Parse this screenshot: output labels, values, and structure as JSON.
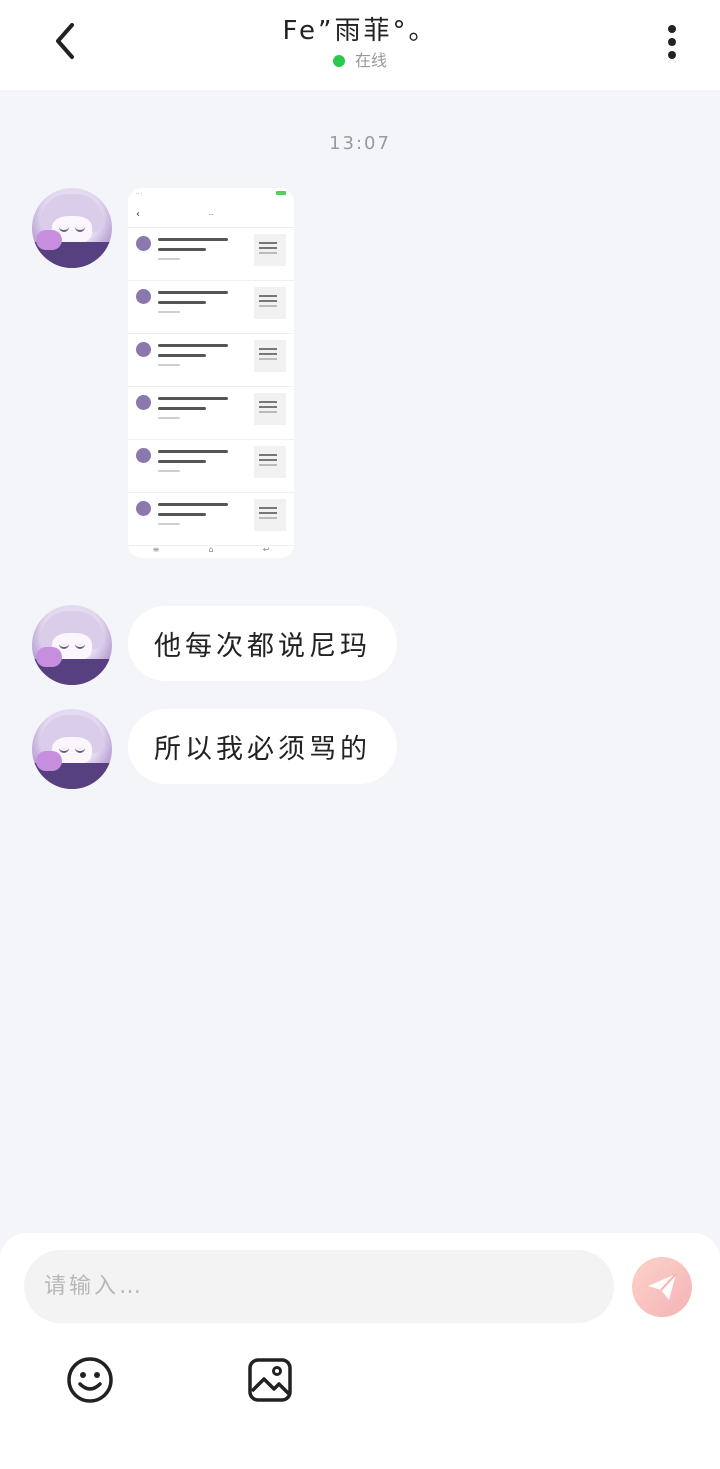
{
  "header": {
    "title": "Fe”雨菲°。",
    "status_text": "在线",
    "icons": {
      "back": "chevron-left-icon",
      "more": "more-vertical-icon"
    }
  },
  "chat": {
    "timestamp": "13:07",
    "messages": [
      {
        "type": "image",
        "sender": "other"
      },
      {
        "type": "text",
        "sender": "other",
        "text": "他每次都说尼玛"
      },
      {
        "type": "text",
        "sender": "other",
        "text": "所以我必须骂的"
      }
    ]
  },
  "composer": {
    "placeholder": "请输入…",
    "icons": {
      "emoji": "emoji-icon",
      "image": "image-icon",
      "send": "send-icon"
    }
  },
  "colors": {
    "background": "#f4f5f8",
    "online": "#2ac84c",
    "send_button": "#f6b2b7"
  }
}
